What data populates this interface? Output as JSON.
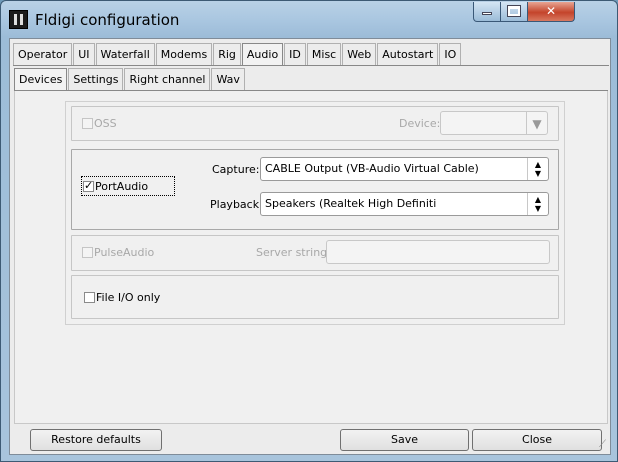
{
  "window": {
    "title": "Fldigi configuration",
    "controls": {
      "minimize": "",
      "maximize": "",
      "close": "✕"
    }
  },
  "tabs": {
    "outer": [
      {
        "label": "Operator"
      },
      {
        "label": "UI"
      },
      {
        "label": "Waterfall"
      },
      {
        "label": "Modems"
      },
      {
        "label": "Rig"
      },
      {
        "label": "Audio",
        "active": true
      },
      {
        "label": "ID"
      },
      {
        "label": "Misc"
      },
      {
        "label": "Web"
      },
      {
        "label": "Autostart"
      },
      {
        "label": "IO"
      }
    ],
    "inner": [
      {
        "label": "Devices",
        "active": true
      },
      {
        "label": "Settings"
      },
      {
        "label": "Right channel"
      },
      {
        "label": "Wav"
      }
    ]
  },
  "devices": {
    "oss": {
      "label": "OSS",
      "checked": false,
      "enabled": false,
      "device_label": "Device:",
      "device_value": ""
    },
    "portaudio": {
      "label": "PortAudio",
      "checked": true,
      "enabled": true,
      "capture_label": "Capture:",
      "capture_value": "CABLE Output (VB-Audio Virtual Cable)",
      "playback_label": "Playback:",
      "playback_value": "Speakers (Realtek High Definiti"
    },
    "pulseaudio": {
      "label": "PulseAudio",
      "checked": false,
      "enabled": false,
      "server_label": "Server string:",
      "server_value": ""
    },
    "file_io": {
      "label": "File I/O only",
      "checked": false,
      "enabled": true
    }
  },
  "footer": {
    "restore_label": "Restore defaults",
    "save_label": "Save",
    "close_label": "Close"
  }
}
